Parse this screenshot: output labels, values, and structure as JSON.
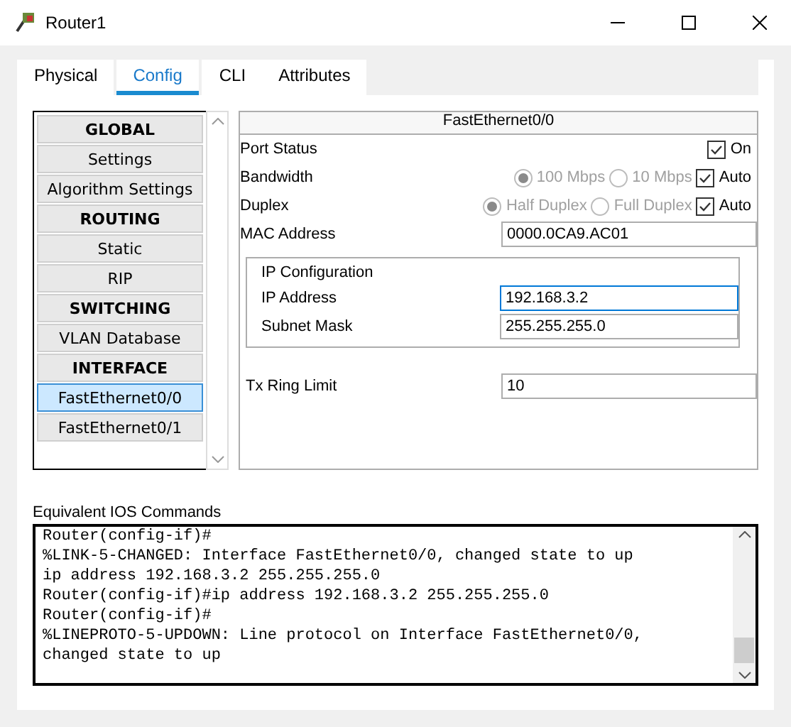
{
  "window": {
    "title": "Router1"
  },
  "tabs": [
    {
      "label": "Physical",
      "selected": false
    },
    {
      "label": "Config",
      "selected": true
    },
    {
      "label": "CLI",
      "selected": false
    },
    {
      "label": "Attributes",
      "selected": false
    }
  ],
  "sidebar": {
    "items": [
      {
        "kind": "header",
        "label": "GLOBAL",
        "selected": false
      },
      {
        "kind": "item",
        "label": "Settings",
        "selected": false
      },
      {
        "kind": "item",
        "label": "Algorithm Settings",
        "selected": false
      },
      {
        "kind": "header",
        "label": "ROUTING",
        "selected": false
      },
      {
        "kind": "item",
        "label": "Static",
        "selected": false
      },
      {
        "kind": "item",
        "label": "RIP",
        "selected": false
      },
      {
        "kind": "header",
        "label": "SWITCHING",
        "selected": false
      },
      {
        "kind": "item",
        "label": "VLAN Database",
        "selected": false
      },
      {
        "kind": "header",
        "label": "INTERFACE",
        "selected": false
      },
      {
        "kind": "item",
        "label": "FastEthernet0/0",
        "selected": true
      },
      {
        "kind": "item",
        "label": "FastEthernet0/1",
        "selected": false
      }
    ]
  },
  "interface": {
    "title": "FastEthernet0/0",
    "port_status": {
      "label": "Port Status",
      "checkbox": {
        "label": "On",
        "checked": true
      }
    },
    "bandwidth": {
      "label": "Bandwidth",
      "options": [
        {
          "label": "100 Mbps",
          "selected": true,
          "disabled": true
        },
        {
          "label": "10 Mbps",
          "selected": false,
          "disabled": true
        }
      ],
      "auto": {
        "label": "Auto",
        "checked": true
      }
    },
    "duplex": {
      "label": "Duplex",
      "options": [
        {
          "label": "Half Duplex",
          "selected": true,
          "disabled": true
        },
        {
          "label": "Full Duplex",
          "selected": false,
          "disabled": true
        }
      ],
      "auto": {
        "label": "Auto",
        "checked": true
      }
    },
    "mac": {
      "label": "MAC Address",
      "value": "0000.0CA9.AC01"
    },
    "ip_config": {
      "title": "IP Configuration",
      "ip": {
        "label": "IP Address",
        "value": "192.168.3.2"
      },
      "mask": {
        "label": "Subnet Mask",
        "value": "255.255.255.0"
      }
    },
    "tx_ring": {
      "label": "Tx Ring Limit",
      "value": "10"
    }
  },
  "console": {
    "label": "Equivalent IOS Commands",
    "lines": [
      "Router(config-if)#",
      "%LINK-5-CHANGED: Interface FastEthernet0/0, changed state to up",
      "ip address 192.168.3.2 255.255.255.0",
      "Router(config-if)#ip address 192.168.3.2 255.255.255.0",
      "Router(config-if)#",
      "%LINEPROTO-5-UPDOWN: Line protocol on Interface FastEthernet0/0,",
      "changed state to up"
    ]
  }
}
